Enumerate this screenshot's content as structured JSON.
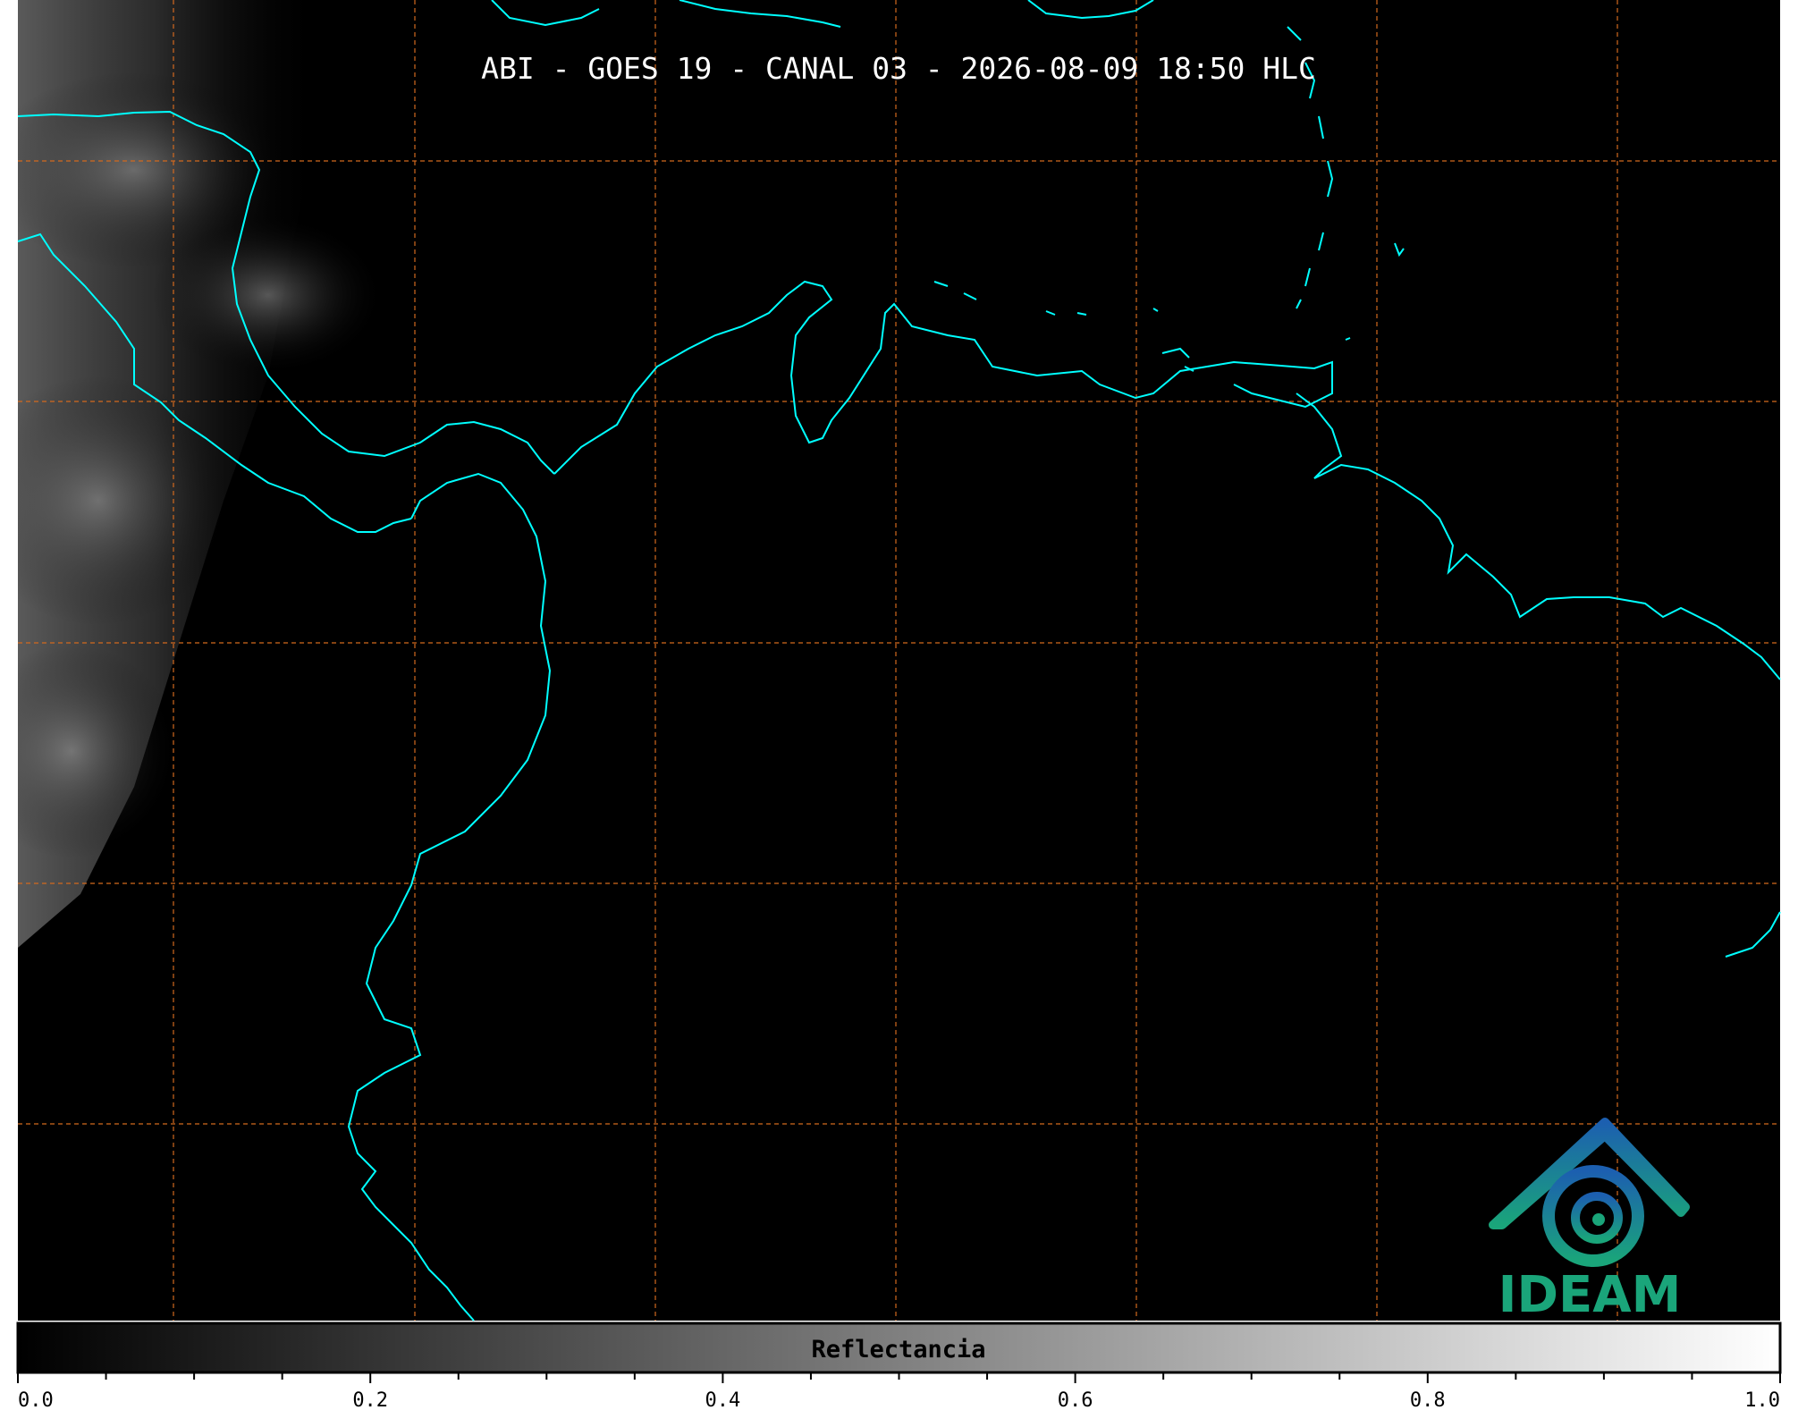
{
  "title": "ABI - GOES 19 - CANAL 03 - 2026-08-09 18:50 HLC",
  "colorbar": {
    "label": "Reflectancia",
    "range": [
      0.0,
      1.0
    ],
    "tick_labels": [
      "0.0",
      "0.2",
      "0.4",
      "0.6",
      "0.8",
      "1.0"
    ],
    "minor_ticks_per_major": 4,
    "colormap": [
      "#000000",
      "#ffffff"
    ]
  },
  "logo": {
    "text": "IDEAM",
    "colors": [
      "#1c5fb0",
      "#1aa57a"
    ]
  },
  "map_style": {
    "background": "#000000",
    "coastline_color": "#00ffff",
    "grid_color": "#d2691e",
    "grid_style": "dashed",
    "cloud_region": "west edge"
  }
}
